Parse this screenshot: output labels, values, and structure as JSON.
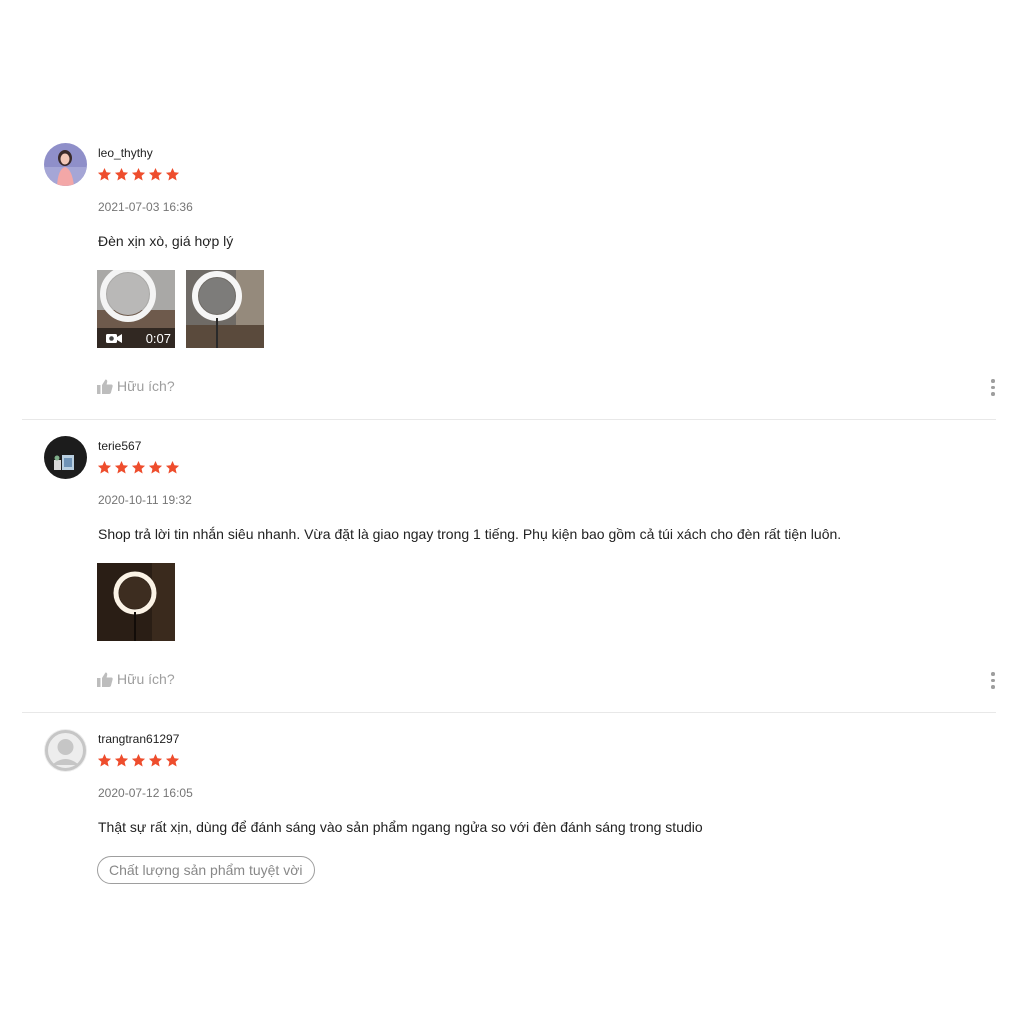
{
  "colors": {
    "star": "#ee4d2d",
    "muted": "#9e9e9e",
    "divider": "#e8e8e8"
  },
  "reviews": [
    {
      "username": "leo_thythy",
      "rating": 5,
      "time": "2021-07-03 16:36",
      "comment": "Đèn xịn xò, giá hợp lý",
      "media": [
        {
          "type": "video",
          "duration": "0:07",
          "icon": "video-camera-icon"
        },
        {
          "type": "image"
        }
      ],
      "helpful_label": "Hữu ích?"
    },
    {
      "username": "terie567",
      "rating": 5,
      "time": "2020-10-11 19:32",
      "comment": "Shop trả lời tin nhắn siêu nhanh. Vừa đặt là giao ngay trong 1 tiếng. Phụ kiện bao gồm cả túi xách cho đèn rất tiện luôn.",
      "media": [
        {
          "type": "image"
        }
      ],
      "helpful_label": "Hữu ích?"
    },
    {
      "username": "trangtran61297",
      "rating": 5,
      "time": "2020-07-12 16:05",
      "comment": "Thật sự rất xịn, dùng để đánh sáng vào sản phẩm ngang ngửa so với đèn đánh sáng trong studio",
      "tag": "Chất lượng sản phẩm tuyệt vời"
    }
  ]
}
